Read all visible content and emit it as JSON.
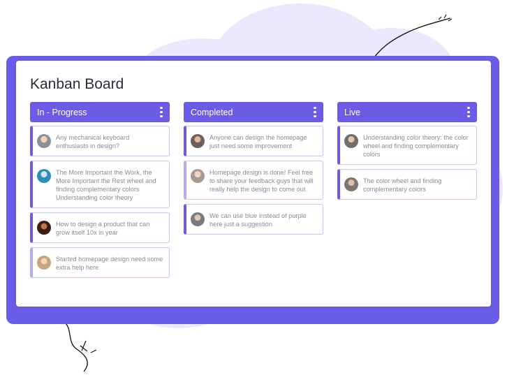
{
  "board": {
    "title": "Kanban Board"
  },
  "columns": [
    {
      "title": "In - Progress",
      "cards": [
        {
          "text": "Any mechanical keyboard enthusiasts in design?",
          "avatar": "#8c8f96",
          "accent": "dark"
        },
        {
          "text": "The More Important the Work, the More Important the Rest wheel and finding complementary colors Understanding color theory",
          "avatar": "#2b8fb3",
          "accent": "dark"
        },
        {
          "text": "How to design a product that can grow itself 10x in year",
          "avatar": "#6b3a22",
          "accent": "dark"
        },
        {
          "text": "Started homepage design need some extra help here",
          "avatar": "#c9a27e",
          "accent": "light"
        }
      ]
    },
    {
      "title": "Completed",
      "cards": [
        {
          "text": "Anyone can design the homepage just need some improvement",
          "avatar": "#6d5f57",
          "accent": "dark"
        },
        {
          "text": "Homepage design is done! Feel free to share your feedback guys that will really help the design to come out",
          "avatar": "#a79a95",
          "accent": "light"
        },
        {
          "text": "We can use blue instead of purple here just a suggestion",
          "avatar": "#7a7a7a",
          "accent": "dark"
        }
      ]
    },
    {
      "title": "Live",
      "cards": [
        {
          "text": "Understanding color theory: the color wheel and finding complementary colors",
          "avatar": "#6e6e6e",
          "accent": "dark"
        },
        {
          "text": "The color wheel and finding complementary colors",
          "avatar": "#7c7470",
          "accent": "dark"
        }
      ]
    }
  ],
  "colors": {
    "accent": "#6a5ce6",
    "accent_light": "#b4acf0",
    "card_border": "#c9c4f3",
    "cloud": "#ebe8fd",
    "text_muted": "#8a8a96"
  },
  "icons": {
    "column_menu": "kebab-vertical-icon"
  }
}
